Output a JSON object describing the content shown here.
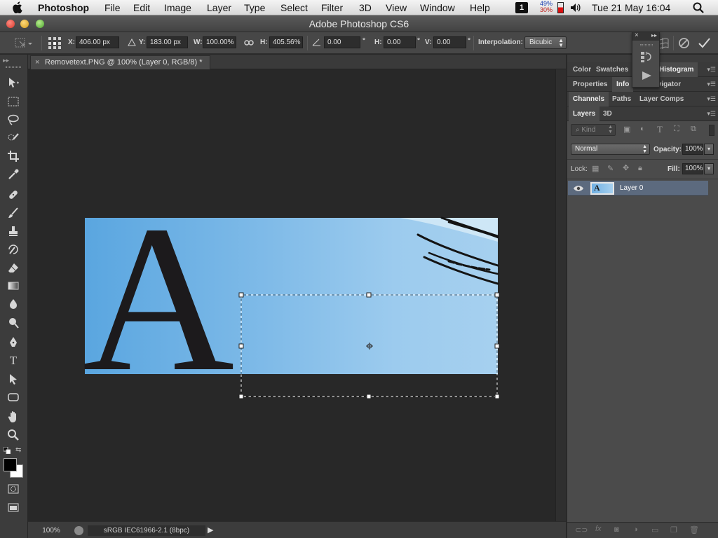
{
  "menubar": {
    "app_name": "Photoshop",
    "menus": [
      "File",
      "Edit",
      "Image",
      "Layer",
      "Type",
      "Select",
      "Filter",
      "3D",
      "View",
      "Window",
      "Help"
    ],
    "status_badge": "1",
    "cpu_top": "49%",
    "cpu_bottom": "30%",
    "clock": "Tue 21 May  16:04"
  },
  "window": {
    "title": "Adobe Photoshop CS6"
  },
  "options": {
    "x_label": "X:",
    "x_value": "406.00 px",
    "y_label": "Y:",
    "y_value": "183.00 px",
    "w_label": "W:",
    "w_value": "100.00%",
    "h_label": "H:",
    "h_value": "405.56%",
    "angle_value": "0.00",
    "deg_symbol": "°",
    "hskew_label": "H:",
    "hskew_value": "0.00",
    "vskew_label": "V:",
    "vskew_value": "0.00",
    "interp_label": "Interpolation:",
    "interp_value": "Bicubic"
  },
  "document": {
    "tab_title": "Removetext.PNG @ 100% (Layer 0, RGB/8) *",
    "close_glyph": "×",
    "big_letter": "A"
  },
  "status": {
    "zoom": "100%",
    "profile": "sRGB IEC61966-2.1 (8bpc)"
  },
  "panels": {
    "row1": [
      "Color",
      "Swatches",
      "Histogram"
    ],
    "row2": [
      "Properties",
      "Info",
      "Navigator"
    ],
    "row3": [
      "Channels",
      "Paths",
      "Layer Comps"
    ],
    "row4": [
      "Layers",
      "3D"
    ],
    "filter_kind": "Kind",
    "blend_mode": "Normal",
    "opacity_label": "Opacity:",
    "opacity_value": "100%",
    "lock_label": "Lock:",
    "fill_label": "Fill:",
    "fill_value": "100%",
    "layer_name": "Layer 0"
  }
}
